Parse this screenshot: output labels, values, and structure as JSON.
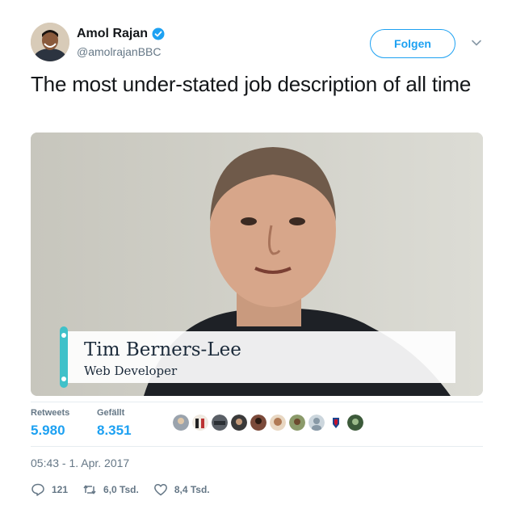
{
  "author": {
    "display_name": "Amol Rajan",
    "handle": "@amolrajanBBC",
    "verified": true
  },
  "follow_button": {
    "label": "Folgen"
  },
  "tweet": {
    "text": "The most under-stated job description of all time"
  },
  "video": {
    "lower_third_name": "Tim Berners-Lee",
    "lower_third_role": "Web Developer"
  },
  "stats": {
    "retweets_label": "Retweets",
    "retweets_value": "5.980",
    "likes_label": "Gefällt",
    "likes_value": "8.351"
  },
  "timestamp": "05:43 - 1. Apr. 2017",
  "actions": {
    "reply_count": "121",
    "retweet_count": "6,0 Tsd.",
    "like_count": "8,4 Tsd."
  },
  "colors": {
    "accent": "#1da1f2",
    "text": "#14171a",
    "muted": "#657786",
    "lower_third_accent": "#3fc1c9"
  },
  "icons": {
    "verified": "verified-badge-icon",
    "caret": "chevron-down-icon",
    "reply": "reply-icon",
    "retweet": "retweet-icon",
    "like": "heart-icon"
  }
}
